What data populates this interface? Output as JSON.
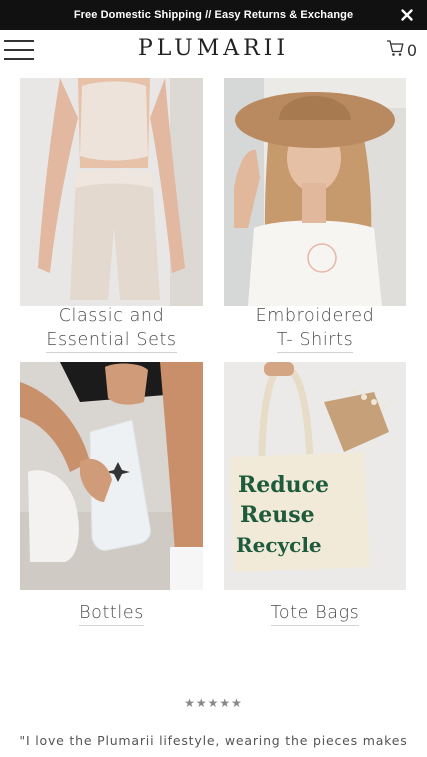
{
  "announcement": {
    "text": "Free Domestic Shipping // Easy Returns & Exchange"
  },
  "header": {
    "logo": "PLUMARII",
    "cart_count": "0"
  },
  "collections": [
    {
      "line1": "Classic and",
      "line2": "Essential Sets",
      "image": "model in cream crop top and biker shorts"
    },
    {
      "line1": "Embroidered",
      "line2": "T- Shirts",
      "image": "model in tan hat and white tee"
    },
    {
      "line1": "Bottles",
      "line2": "",
      "image": "frosted glass bottle held by hand"
    },
    {
      "line1": "Tote Bags",
      "line2": "",
      "image": "canvas tote bag printed Reduce Reuse Recycle"
    }
  ],
  "tote_print": [
    "Reduce",
    "Reuse",
    "Recycle"
  ],
  "rating": {
    "stars": "★★★★★",
    "value": 5
  },
  "testimonial": {
    "text": "\"I love the Plumarii lifestyle, wearing the pieces makes"
  },
  "colors": {
    "announcement_bg": "#111111",
    "text": "#4a4a4a",
    "tote_ink": "#1e5a3c"
  }
}
